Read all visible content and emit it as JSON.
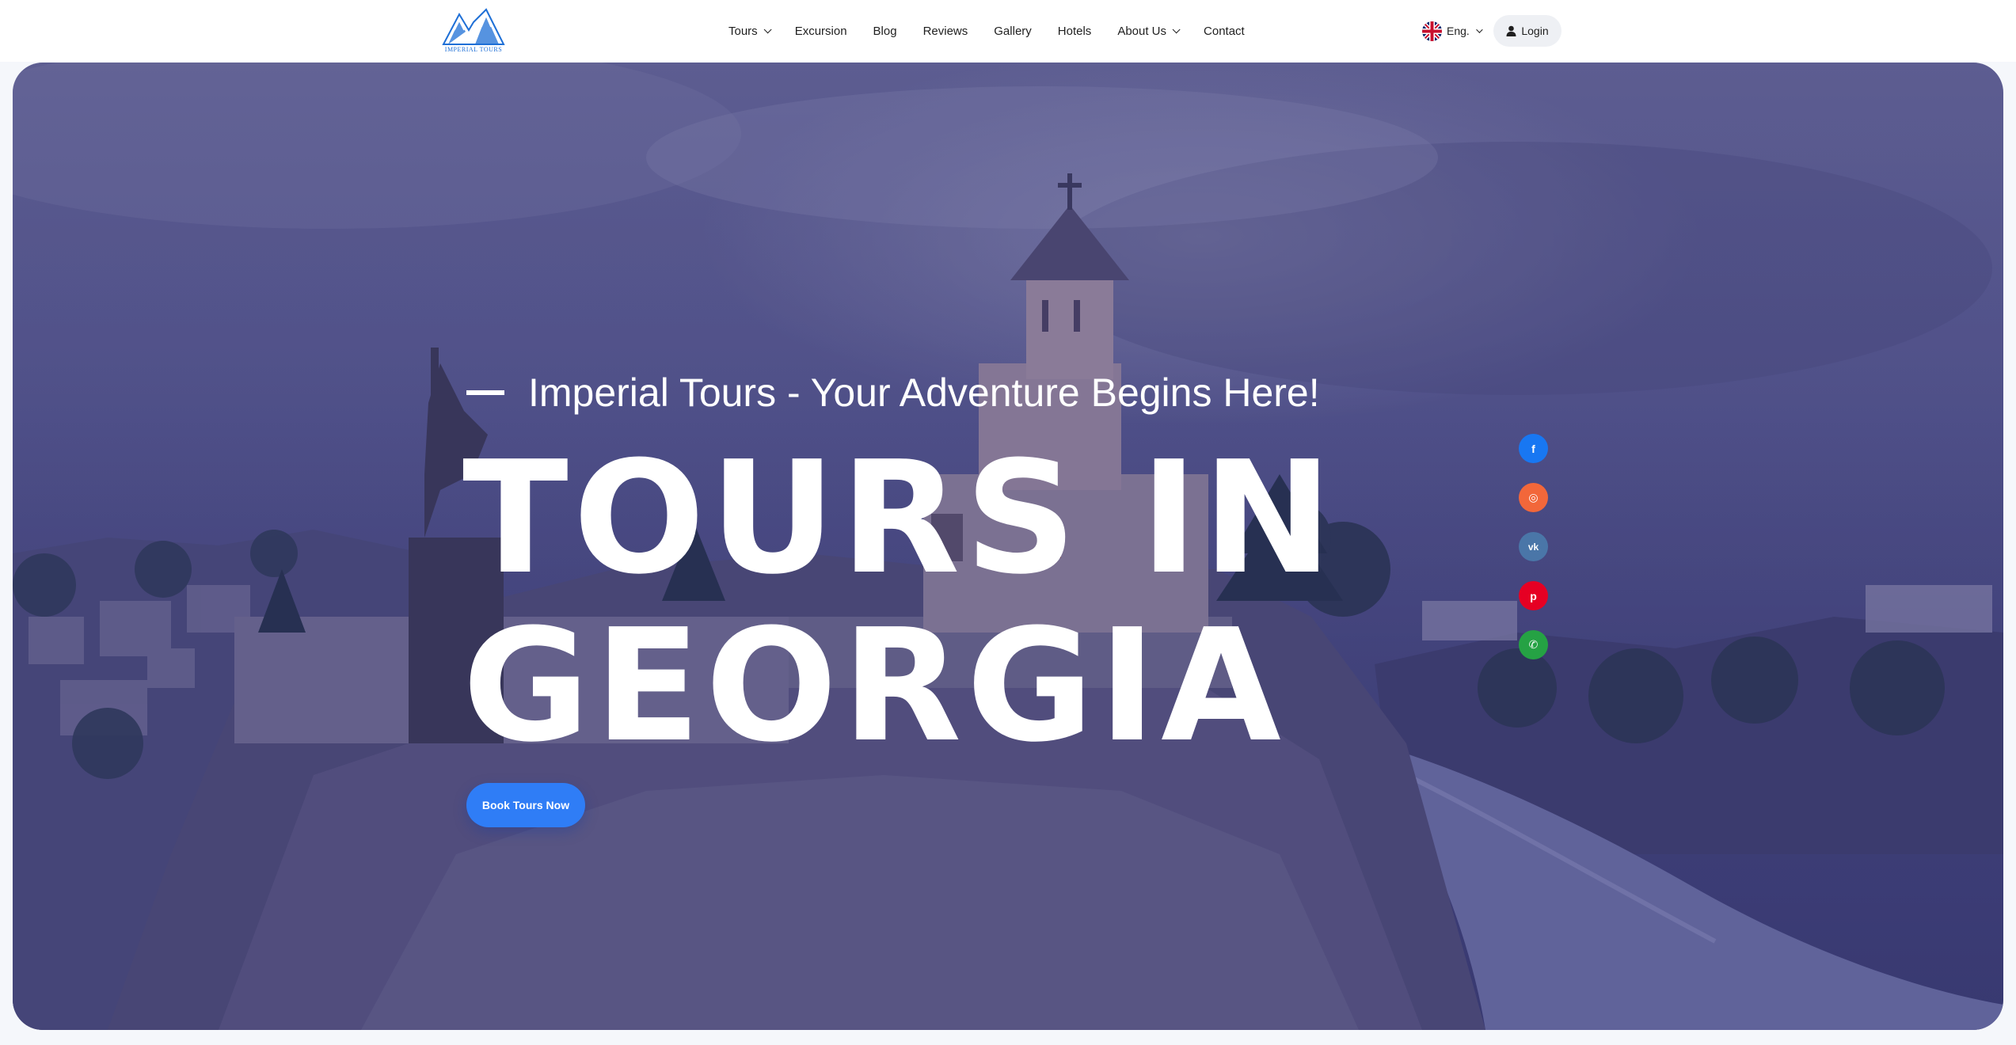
{
  "header": {
    "logo_text": "IMPERIAL TOURS",
    "nav": [
      {
        "label": "Tours",
        "has_dropdown": true
      },
      {
        "label": "Excursion",
        "has_dropdown": false
      },
      {
        "label": "Blog",
        "has_dropdown": false
      },
      {
        "label": "Reviews",
        "has_dropdown": false
      },
      {
        "label": "Gallery",
        "has_dropdown": false
      },
      {
        "label": "Hotels",
        "has_dropdown": false
      },
      {
        "label": "About Us",
        "has_dropdown": true
      },
      {
        "label": "Contact",
        "has_dropdown": false
      }
    ],
    "language": {
      "label": "Eng.",
      "flag": "uk-flag-icon"
    },
    "login_label": "Login"
  },
  "hero": {
    "tagline": "Imperial Tours - Your Adventure Begins Here!",
    "headline_line1": "TOURS IN",
    "headline_line2": "GEORGIA",
    "cta_label": "Book Tours Now"
  },
  "social": [
    {
      "name": "facebook",
      "icon": "facebook-icon",
      "glyph": "f",
      "color": "#1877f2"
    },
    {
      "name": "instagram",
      "icon": "instagram-icon",
      "glyph": "◎",
      "color": "#f2673a"
    },
    {
      "name": "vk",
      "icon": "vk-icon",
      "glyph": "vk",
      "color": "#4a76a8"
    },
    {
      "name": "pinterest",
      "icon": "pinterest-icon",
      "glyph": "p",
      "color": "#e60023"
    },
    {
      "name": "whatsapp",
      "icon": "whatsapp-icon",
      "glyph": "✆",
      "color": "#25a244"
    }
  ],
  "colors": {
    "accent": "#2f7df6",
    "hero_tint": "#4b4c80",
    "header_bg": "#ffffff"
  }
}
